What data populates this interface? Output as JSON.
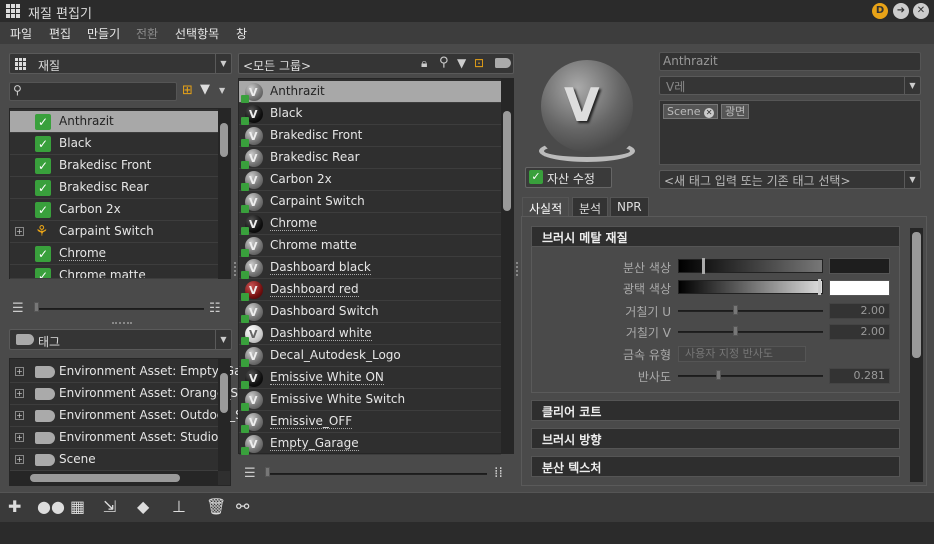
{
  "window": {
    "title": "재질 편집기",
    "btn_d": "D"
  },
  "menu": [
    "파일",
    "편집",
    "만들기",
    "전환",
    "선택항목",
    "창"
  ],
  "left_panel": {
    "combo_label": "재질",
    "materials": [
      "Anthrazit",
      "Black",
      "Brakedisc Front",
      "Brakedisc Rear",
      "Carbon 2x",
      "Carpaint Switch",
      "Chrome",
      "Chrome matte"
    ],
    "tag_combo_label": "태그",
    "tags": [
      "Environment Asset: Empty_Ga",
      "Environment Asset: Orange_S",
      "Environment Asset: Outdoor_S",
      "Environment Asset: Studio",
      "Scene"
    ]
  },
  "middle_panel": {
    "group_label": "<모든 그룹>",
    "items": [
      "Anthrazit",
      "Black",
      "Brakedisc Front",
      "Brakedisc Rear",
      "Carbon 2x",
      "Carpaint Switch",
      "Chrome",
      "Chrome matte",
      "Dashboard black",
      "Dashboard red",
      "Dashboard Switch",
      "Dashboard white",
      "Decal_Autodesk_Logo",
      "Emissive White ON",
      "Emissive White Switch",
      "Emissive_OFF",
      "Empty_Garage"
    ]
  },
  "right_panel": {
    "name": "Anthrazit",
    "type": "V레",
    "tags": [
      "Scene",
      "광면"
    ],
    "tag_placeholder": "<새 태그 입력 또는 기존 태그 선택>",
    "asset_edit": "자산 수정",
    "tabs": [
      "사실적",
      "분석",
      "NPR"
    ],
    "sections": [
      "브러시 메탈 재질",
      "클리어 코트",
      "브러시 방향",
      "분산 텍스처"
    ],
    "props": {
      "diffuse_color": "분산 색상",
      "gloss_color": "광택 색상",
      "roughness_u": "거칠기 U",
      "roughness_u_val": "2.00",
      "roughness_v": "거칠기 V",
      "roughness_v_val": "2.00",
      "metal_type": "금속 유형",
      "metal_type_val": "사용자 지정 반사도",
      "reflectivity": "반사도",
      "reflectivity_val": "0.281"
    }
  },
  "colors": {
    "accent_green": "#39a03c",
    "selection": "#a8a8a8",
    "d_button": "#e8a317"
  }
}
